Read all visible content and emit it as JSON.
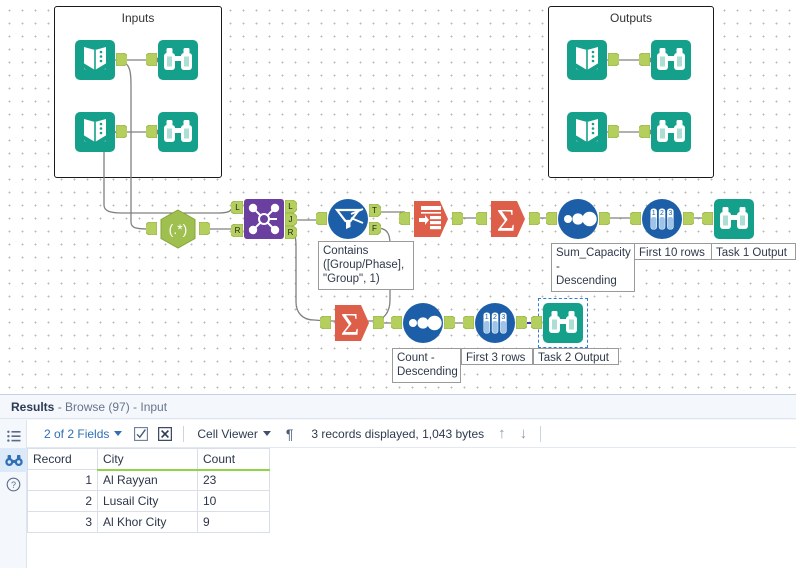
{
  "canvas": {
    "containers": [
      {
        "name": "inputs-container",
        "label": "Inputs"
      },
      {
        "name": "outputs-container",
        "label": "Outputs"
      }
    ],
    "tools": [
      {
        "id": "input-data-1",
        "kind": "input-data-icon",
        "label": "Input Data"
      },
      {
        "id": "browse-in-1",
        "kind": "browse-icon",
        "label": "Browse"
      },
      {
        "id": "input-data-2",
        "kind": "input-data-icon",
        "label": "Input Data"
      },
      {
        "id": "browse-in-2",
        "kind": "browse-icon",
        "label": "Browse"
      },
      {
        "id": "input-data-3",
        "kind": "input-data-icon",
        "label": "Input Data"
      },
      {
        "id": "browse-out-1",
        "kind": "browse-icon",
        "label": "Browse"
      },
      {
        "id": "input-data-4",
        "kind": "input-data-icon",
        "label": "Input Data"
      },
      {
        "id": "browse-out-2",
        "kind": "browse-icon",
        "label": "Browse"
      },
      {
        "id": "regex-1",
        "kind": "regex-icon",
        "label": "RegEx",
        "glyph": "(.*)"
      },
      {
        "id": "join-1",
        "kind": "join-icon",
        "label": "Join"
      },
      {
        "id": "filter-1",
        "kind": "filter-icon",
        "label": "Filter"
      },
      {
        "id": "select-1",
        "kind": "select-icon",
        "label": "Select"
      },
      {
        "id": "summarize-1",
        "kind": "summarize-icon",
        "label": "Summarize",
        "glyph": "Σ"
      },
      {
        "id": "sort-1",
        "kind": "sort-icon",
        "label": "Sort"
      },
      {
        "id": "sample-1",
        "kind": "sample-icon",
        "label": "Sample"
      },
      {
        "id": "browse-task1",
        "kind": "browse-icon",
        "label": "Browse"
      },
      {
        "id": "summarize-2",
        "kind": "summarize-icon",
        "label": "Summarize",
        "glyph": "Σ"
      },
      {
        "id": "sort-2",
        "kind": "sort-icon",
        "label": "Sort"
      },
      {
        "id": "sample-2",
        "kind": "sample-icon",
        "label": "Sample"
      },
      {
        "id": "browse-task2",
        "kind": "browse-icon",
        "label": "Browse",
        "selected": true
      }
    ],
    "anchors": {
      "join_in_left": "L",
      "join_in_right": "R",
      "join_out_left": "L",
      "join_out_join": "J",
      "join_out_right": "R",
      "filter_true": "T",
      "filter_false": "F"
    },
    "annotations": [
      {
        "name": "filter-annotation",
        "text": "Contains\n([Group/Phase],\n\"Group\", 1)"
      },
      {
        "name": "sort1-annotation",
        "text": "Sum_Capacity -\nDescending"
      },
      {
        "name": "sample1-annotation",
        "text": "First 10 rows"
      },
      {
        "name": "browse-task1-annotation",
        "text": "Task 1 Output"
      },
      {
        "name": "sort2-annotation",
        "text": "Count -\nDescending"
      },
      {
        "name": "sample2-annotation",
        "text": "First 3 rows"
      },
      {
        "name": "browse-task2-annotation",
        "text": "Task 2 Output"
      }
    ]
  },
  "results": {
    "title_label": "Results",
    "title_sub": " - Browse (97) - Input",
    "toolbar": {
      "fields_label": "2 of 2 Fields",
      "select_all_icon": "checkbox-checked-icon",
      "deselect_all_icon": "checkbox-x-icon",
      "view_mode_label": "Cell Viewer",
      "pilcrow_icon": "¶",
      "status_text": "3 records displayed, 1,043 bytes",
      "up_arrow_icon": "↑",
      "down_arrow_icon": "↓"
    },
    "rail": [
      {
        "name": "rail-list-icon",
        "icon": "list-icon",
        "active": false
      },
      {
        "name": "rail-browse-icon",
        "icon": "binoculars-icon",
        "active": true
      },
      {
        "name": "rail-help-icon",
        "icon": "question-circle-icon",
        "active": false
      }
    ],
    "table": {
      "columns": [
        "Record",
        "City",
        "Count"
      ],
      "rows": [
        {
          "record": "1",
          "city": "Al Rayyan",
          "count": "23"
        },
        {
          "record": "2",
          "city": "Lusail City",
          "count": "10"
        },
        {
          "record": "3",
          "city": "Al Khor City",
          "count": "9"
        }
      ]
    }
  },
  "colors": {
    "teal": "#14a08a",
    "purple": "#6b3fa0",
    "blue": "#1c5fa8",
    "orange": "#dd5f4a",
    "green_hex": "#9fbf4f",
    "anchor_green": "#b5cf5e",
    "accent_link": "#2f6fb5",
    "grid_green": "#8fd44a"
  }
}
